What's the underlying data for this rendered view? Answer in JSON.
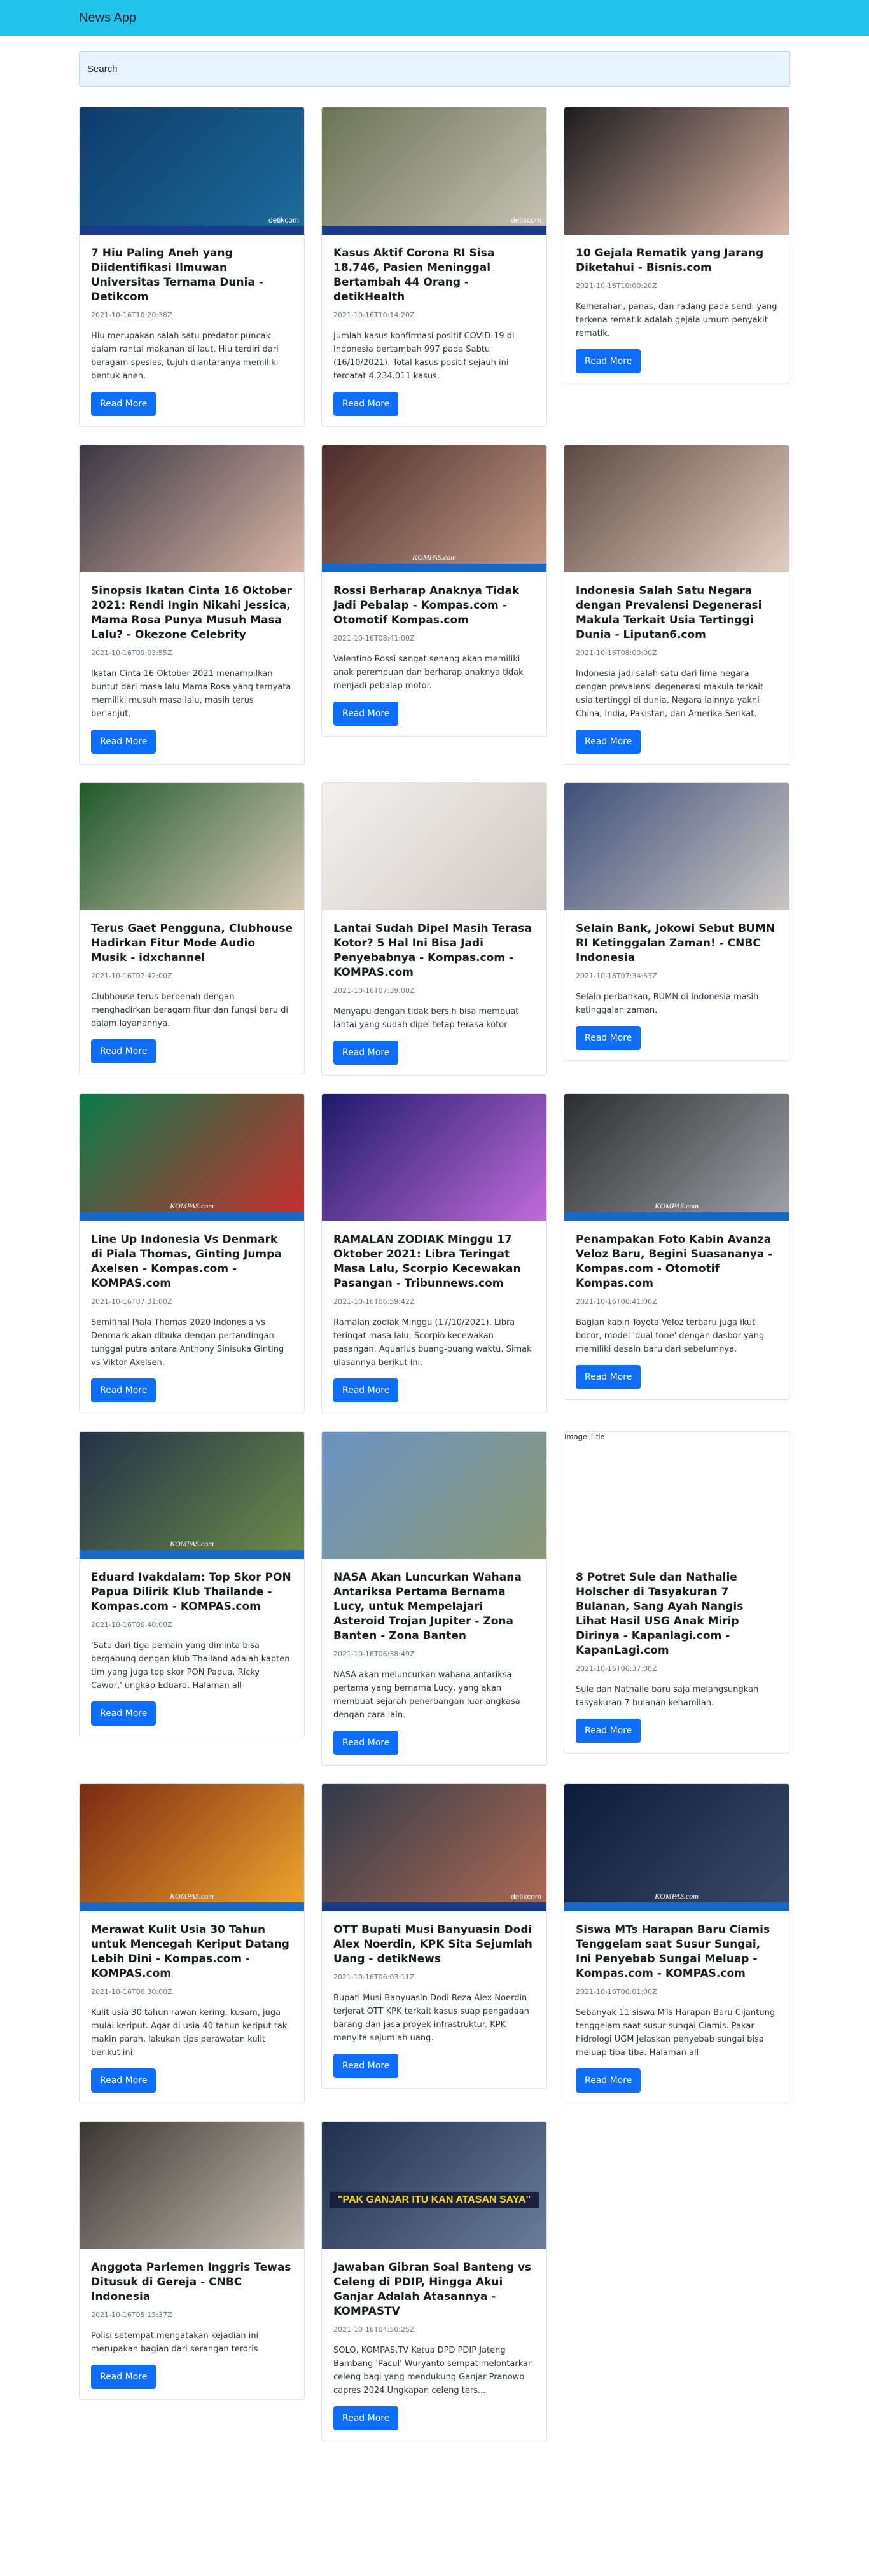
{
  "app": {
    "title": "News App"
  },
  "search": {
    "value": "Search"
  },
  "button_label": "Read More",
  "image_alt_placeholder": "Image Title",
  "articles": [
    {
      "title": "7 Hiu Paling Aneh yang Diidentifikasi Ilmuwan Universitas Ternama Dunia - Detikcom",
      "date": "2021-10-16T10:20:38Z",
      "text": "Hiu merupakan salah satu predator puncak dalam rantai makanan di laut. Hiu terdiri dari beragam spesies, tujuh diantaranya memiliki bentuk aneh.",
      "image": {
        "colors": [
          "#0f3b6a",
          "#1b6d9c"
        ],
        "watermark": "detikcom",
        "bar": "#1a3b8c"
      }
    },
    {
      "title": "Kasus Aktif Corona RI Sisa 18.746, Pasien Meninggal Bertambah 44 Orang - detikHealth",
      "date": "2021-10-16T10:14:20Z",
      "text": "Jumlah kasus konfirmasi positif COVID-19 di Indonesia bertambah 997 pada Sabtu (16/10/2021). Total kasus positif sejauh ini tercatat 4.234.011 kasus.",
      "image": {
        "colors": [
          "#6c7355",
          "#c7c3b6"
        ],
        "watermark": "detikcom",
        "bar": "#1a3b8c"
      }
    },
    {
      "title": "10 Gejala Rematik yang Jarang Diketahui - Bisnis.com",
      "date": "2021-10-16T10:00:20Z",
      "text": "Kemerahan, panas, dan radang pada sendi yang terkena rematik adalah gejala umum penyakit rematik.",
      "image": {
        "colors": [
          "#1c1b1d",
          "#d9b4a5"
        ],
        "watermark": "",
        "bar": ""
      }
    },
    {
      "title": "Sinopsis Ikatan Cinta 16 Oktober 2021: Rendi Ingin Nikahi Jessica, Mama Rosa Punya Musuh Masa Lalu? - Okezone Celebrity",
      "date": "2021-10-16T09:03:55Z",
      "text": "Ikatan Cinta 16 Oktober 2021 menampilkan buntut dari masa lalu Mama Rosa yang ternyata memiliki musuh masa lalu, masih terus berlanjut.",
      "image": {
        "colors": [
          "#3b3744",
          "#d8b6a6"
        ],
        "watermark": "",
        "bar": ""
      }
    },
    {
      "title": "Rossi Berharap Anaknya Tidak Jadi Pebalap - Kompas.com - Otomotif Kompas.com",
      "date": "2021-10-16T08:41:00Z",
      "text": "Valentino Rossi sangat senang akan memiliki anak perempuan dan berharap anaknya tidak menjadi pebalap motor.",
      "image": {
        "colors": [
          "#4a2b2a",
          "#c49b86"
        ],
        "watermark": "KOMPAS.com",
        "bar": "#1668c9"
      }
    },
    {
      "title": "Indonesia Salah Satu Negara dengan Prevalensi Degenerasi Makula Terkait Usia Tertinggi Dunia - Liputan6.com",
      "date": "2021-10-16T08:00:00Z",
      "text": "Indonesia jadi salah satu dari lima negara dengan prevalensi degenerasi makula terkait usia tertinggi di dunia. Negara lainnya yakni China, India, Pakistan, dan Amerika Serikat.",
      "image": {
        "colors": [
          "#5b4a42",
          "#e1cfc4"
        ],
        "watermark": "",
        "bar": ""
      }
    },
    {
      "title": "Terus Gaet Pengguna, Clubhouse Hadirkan Fitur Mode Audio Musik - idxchannel",
      "date": "2021-10-16T07:42:00Z",
      "text": "Clubhouse terus berbenah dengan menghadirkan beragam fitur dan fungsi baru di dalam layanannya.",
      "image": {
        "colors": [
          "#1f5a2b",
          "#d8c9b4"
        ],
        "watermark": "",
        "bar": ""
      }
    },
    {
      "title": "Lantai Sudah Dipel Masih Terasa Kotor? 5 Hal Ini Bisa Jadi Penyebabnya - Kompas.com - KOMPAS.com",
      "date": "2021-10-16T07:39:00Z",
      "text": "Menyapu dengan tidak bersih bisa membuat lantai yang sudah dipel tetap terasa kotor",
      "image": {
        "colors": [
          "#f3f1ef",
          "#cfc8c3"
        ],
        "watermark": "",
        "bar": ""
      }
    },
    {
      "title": "Selain Bank, Jokowi Sebut BUMN RI Ketinggalan Zaman! - CNBC Indonesia",
      "date": "2021-10-16T07:34:53Z",
      "text": "Selain perbankan, BUMN di Indonesia masih ketinggalan zaman.",
      "image": {
        "colors": [
          "#3f4f7b",
          "#c9c5c2"
        ],
        "watermark": "",
        "bar": ""
      }
    },
    {
      "title": "Line Up Indonesia Vs Denmark di Piala Thomas, Ginting Jumpa Axelsen - Kompas.com - KOMPAS.com",
      "date": "2021-10-16T07:31:00Z",
      "text": "Semifinal Piala Thomas 2020 Indonesia vs Denmark akan dibuka dengan pertandingan tunggal putra antara Anthony Sinisuka Ginting vs Viktor Axelsen.",
      "image": {
        "colors": [
          "#0a7a4a",
          "#c92e2e"
        ],
        "watermark": "KOMPAS.com",
        "bar": "#1668c9"
      }
    },
    {
      "title": "RAMALAN ZODIAK Minggu 17 Oktober 2021: Libra Teringat Masa Lalu, Scorpio Kecewakan Pasangan - Tribunnews.com",
      "date": "2021-10-16T06:59:42Z",
      "text": "Ramalan zodiak Minggu (17/10/2021). Libra teringat masa lalu, Scorpio kecewakan pasangan, Aquarius buang-buang waktu. Simak ulasannya berikut ini.",
      "image": {
        "colors": [
          "#1e1a6b",
          "#c06bdc"
        ],
        "watermark": "",
        "bar": ""
      }
    },
    {
      "title": "Penampakan Foto Kabin Avanza Veloz Baru, Begini Suasananya - Kompas.com - Otomotif Kompas.com",
      "date": "2021-10-16T06:41:00Z",
      "text": "Bagian kabin Toyota Veloz terbaru juga ikut bocor, model 'dual tone' dengan dasbor yang memiliki desain baru dari sebelumnya.",
      "image": {
        "colors": [
          "#2b2d30",
          "#9fa2a6"
        ],
        "watermark": "KOMPAS.com",
        "bar": "#1668c9"
      }
    },
    {
      "title": "Eduard Ivakdalam: Top Skor PON Papua Dilirik Klub Thailande - Kompas.com - KOMPAS.com",
      "date": "2021-10-16T06:40:00Z",
      "text": "'Satu dari tiga pemain yang diminta bisa bergabung dengan klub Thailand adalah kapten tim yang juga top skor PON Papua, Ricky Cawor,' ungkap Eduard. Halaman all",
      "image": {
        "colors": [
          "#243148",
          "#6d8c4a"
        ],
        "watermark": "KOMPAS.com",
        "bar": "#1668c9"
      }
    },
    {
      "title": "NASA Akan Luncurkan Wahana Antariksa Pertama Bernama Lucy, untuk Mempelajari Asteroid Trojan Jupiter - Zona Banten - Zona Banten",
      "date": "2021-10-16T06:38:49Z",
      "text": "NASA akan meluncurkan wahana antariksa pertama yang bernama Lucy, yang akan membuat sejarah penerbangan luar angkasa dengan cara lain.",
      "image": {
        "colors": [
          "#6a93c4",
          "#8a9873"
        ],
        "watermark": "",
        "bar": ""
      }
    },
    {
      "title": "8 Potret Sule dan Nathalie Holscher di Tasyakuran 7 Bulanan, Sang Ayah Nangis Lihat Hasil USG Anak Mirip Dirinya - Kapanlagi.com - KapanLagi.com",
      "date": "2021-10-16T06:37:00Z",
      "text": "Sule dan Nathalie baru saja melangsungkan tasyakuran 7 bulanan kehamilan.",
      "image": {
        "colors": [
          "#ffffff",
          "#ffffff"
        ],
        "watermark": "",
        "bar": "",
        "missing": true
      }
    },
    {
      "title": "Merawat Kulit Usia 30 Tahun untuk Mencegah Keriput Datang Lebih Dini - Kompas.com - KOMPAS.com",
      "date": "2021-10-16T06:30:00Z",
      "text": "Kulit usia 30 tahun rawan kering, kusam, juga mulai keriput. Agar di usia 40 tahun keriput tak makin parah, lakukan tips perawatan kulit berikut ini.",
      "image": {
        "colors": [
          "#7a2a12",
          "#f2a62e"
        ],
        "watermark": "KOMPAS.com",
        "bar": "#1668c9"
      }
    },
    {
      "title": "OTT Bupati Musi Banyuasin Dodi Alex Noerdin, KPK Sita Sejumlah Uang - detikNews",
      "date": "2021-10-16T06:03:11Z",
      "text": "Bupati Musi Banyuasin Dodi Reza Alex Noerdin terjerat OTT KPK terkait kasus suap pengadaan barang dan jasa proyek infrastruktur. KPK menyita sejumlah uang.",
      "image": {
        "colors": [
          "#2f3a4a",
          "#b06a52"
        ],
        "watermark": "detikcom",
        "bar": "#1a3b8c"
      }
    },
    {
      "title": "Siswa MTs Harapan Baru Ciamis Tenggelam saat Susur Sungai, Ini Penyebab Sungai Meluap - Kompas.com - KOMPAS.com",
      "date": "2021-10-16T06:01:00Z",
      "text": "Sebanyak 11 siswa MTs Harapan Baru Cijantung tenggelam saat susur sungai Ciamis. Pakar hidrologi UGM jelaskan penyebab sungai bisa meluap tiba-tiba. Halaman all",
      "image": {
        "colors": [
          "#0d1b3a",
          "#3b4b6a"
        ],
        "watermark": "KOMPAS.com",
        "bar": "#1668c9"
      }
    },
    {
      "title": "Anggota Parlemen Inggris Tewas Ditusuk di Gereja - CNBC Indonesia",
      "date": "2021-10-16T05:15:37Z",
      "text": "Polisi setempat mengatakan kejadian ini merupakan bagian dari serangan teroris",
      "image": {
        "colors": [
          "#3a3632",
          "#c8bfb3"
        ],
        "watermark": "",
        "bar": ""
      }
    },
    {
      "title": "Jawaban Gibran Soal Banteng vs Celeng di PDIP, Hingga Akui Ganjar Adalah Atasannya - KOMPASTV",
      "date": "2021-10-16T04:50:25Z",
      "text": "SOLO, KOMPAS.TV Ketua DPD PDIP Jateng Bambang 'Pacul' Wuryanto sempat melontarkan celeng bagi yang mendukung Ganjar Pranowo capres 2024.Ungkapan celeng ters...",
      "image": {
        "colors": [
          "#1f2f4f",
          "#6a7e9a"
        ],
        "watermark": "",
        "bar": "",
        "caption": "\"PAK GANJAR ITU KAN ATASAN SAYA\""
      }
    }
  ]
}
